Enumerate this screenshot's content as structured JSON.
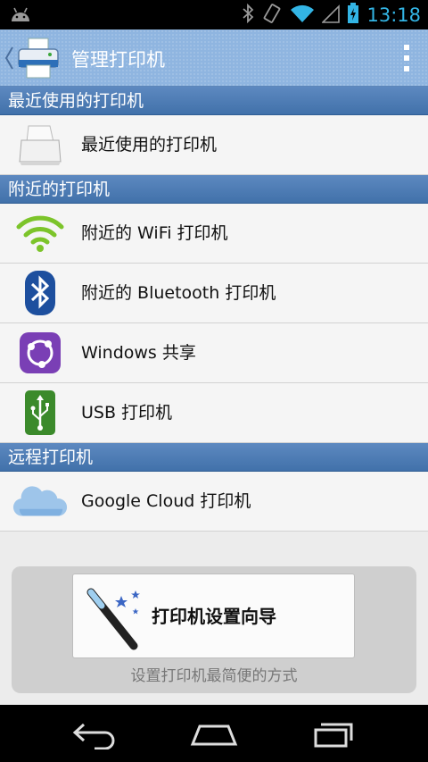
{
  "status_bar": {
    "time": "13:18",
    "icons": [
      "android-icon",
      "bluetooth-icon",
      "vibrate-icon",
      "wifi-icon",
      "signal-icon",
      "battery-icon"
    ]
  },
  "action_bar": {
    "title": "管理打印机",
    "back_icon": "chevron-left-icon",
    "app_icon": "printer-app-icon",
    "overflow_icon": "overflow-menu-icon"
  },
  "sections": [
    {
      "header": "最近使用的打印机",
      "items": [
        {
          "label": "最近使用的打印机",
          "icon": "printer-icon"
        }
      ]
    },
    {
      "header": "附近的打印机",
      "items": [
        {
          "label": "附近的 WiFi 打印机",
          "icon": "wifi-icon"
        },
        {
          "label": "附近的 Bluetooth 打印机",
          "icon": "bluetooth-icon"
        },
        {
          "label": "Windows 共享",
          "icon": "share-icon"
        },
        {
          "label": "USB 打印机",
          "icon": "usb-icon"
        }
      ]
    },
    {
      "header": "远程打印机",
      "items": [
        {
          "label": "Google Cloud 打印机",
          "icon": "cloud-icon"
        }
      ]
    }
  ],
  "wizard": {
    "button_label": "打印机设置向导",
    "hint": "设置打印机最简便的方式",
    "icon": "magic-wand-icon"
  },
  "nav_bar": {
    "icons": [
      "back-icon",
      "home-icon",
      "recents-icon"
    ]
  },
  "colors": {
    "section_header": "#4a78b2",
    "action_bar": "#8fb5e0",
    "status_accent": "#33b5e5"
  }
}
